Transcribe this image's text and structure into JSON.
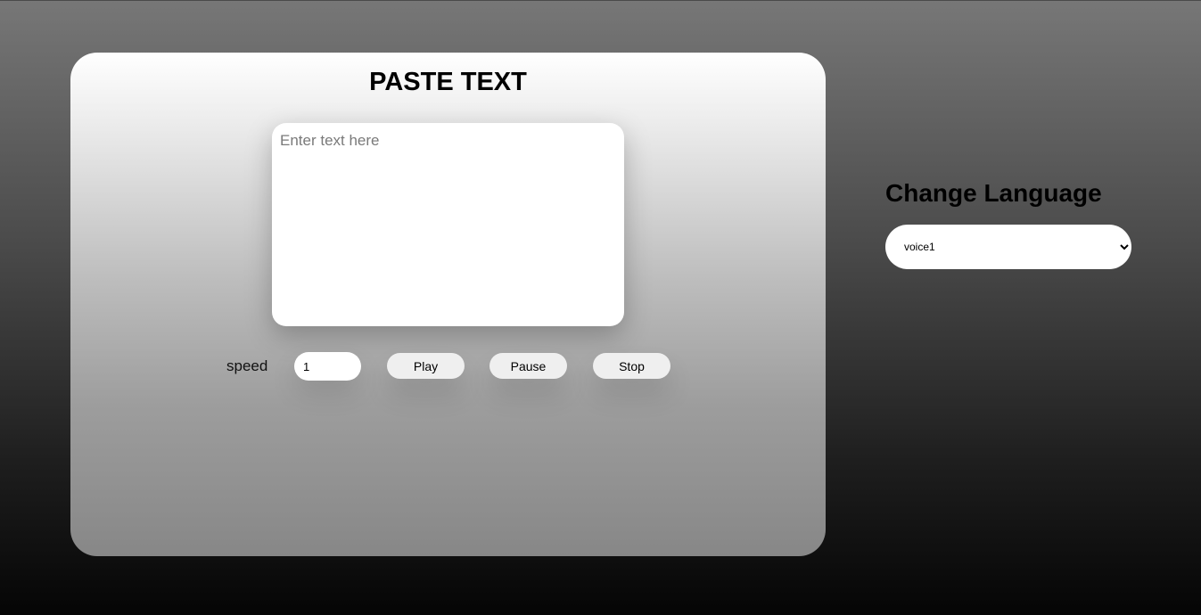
{
  "editor": {
    "title": "PASTE TEXT",
    "textarea_value": "",
    "textarea_placeholder": "Enter text here"
  },
  "controls": {
    "speed_label": "speed",
    "speed_value": "1",
    "play_label": "Play",
    "pause_label": "Pause",
    "stop_label": "Stop"
  },
  "language": {
    "title": "Change Language",
    "selected_voice": "voice1",
    "options": [
      "voice1"
    ]
  }
}
